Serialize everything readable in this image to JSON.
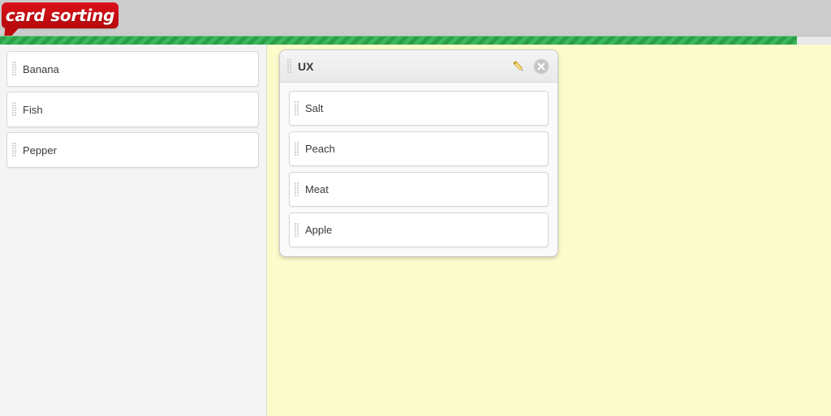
{
  "app": {
    "logo_text": "card sorting",
    "logo_color": "#c60c10",
    "header_color": "#cccccc",
    "accent_stripe_color": "#35ad52",
    "board_color": "#fbfbcc",
    "tray_color": "#f4f4f4"
  },
  "tray": {
    "name": "unsorted-cards-tray",
    "cards": [
      {
        "label": "Banana",
        "handle": "drag-handle"
      },
      {
        "label": "Fish",
        "handle": "drag-handle"
      },
      {
        "label": "Pepper",
        "handle": "drag-handle"
      }
    ]
  },
  "board": {
    "groups": [
      {
        "title": "UX",
        "edit_icon": "pencil-icon",
        "close_icon": "close-circle-icon",
        "cards": [
          {
            "label": "Salt",
            "handle": "drag-handle"
          },
          {
            "label": "Peach",
            "handle": "drag-handle"
          },
          {
            "label": "Meat",
            "handle": "drag-handle"
          },
          {
            "label": "Apple",
            "handle": "drag-handle"
          }
        ]
      }
    ]
  }
}
